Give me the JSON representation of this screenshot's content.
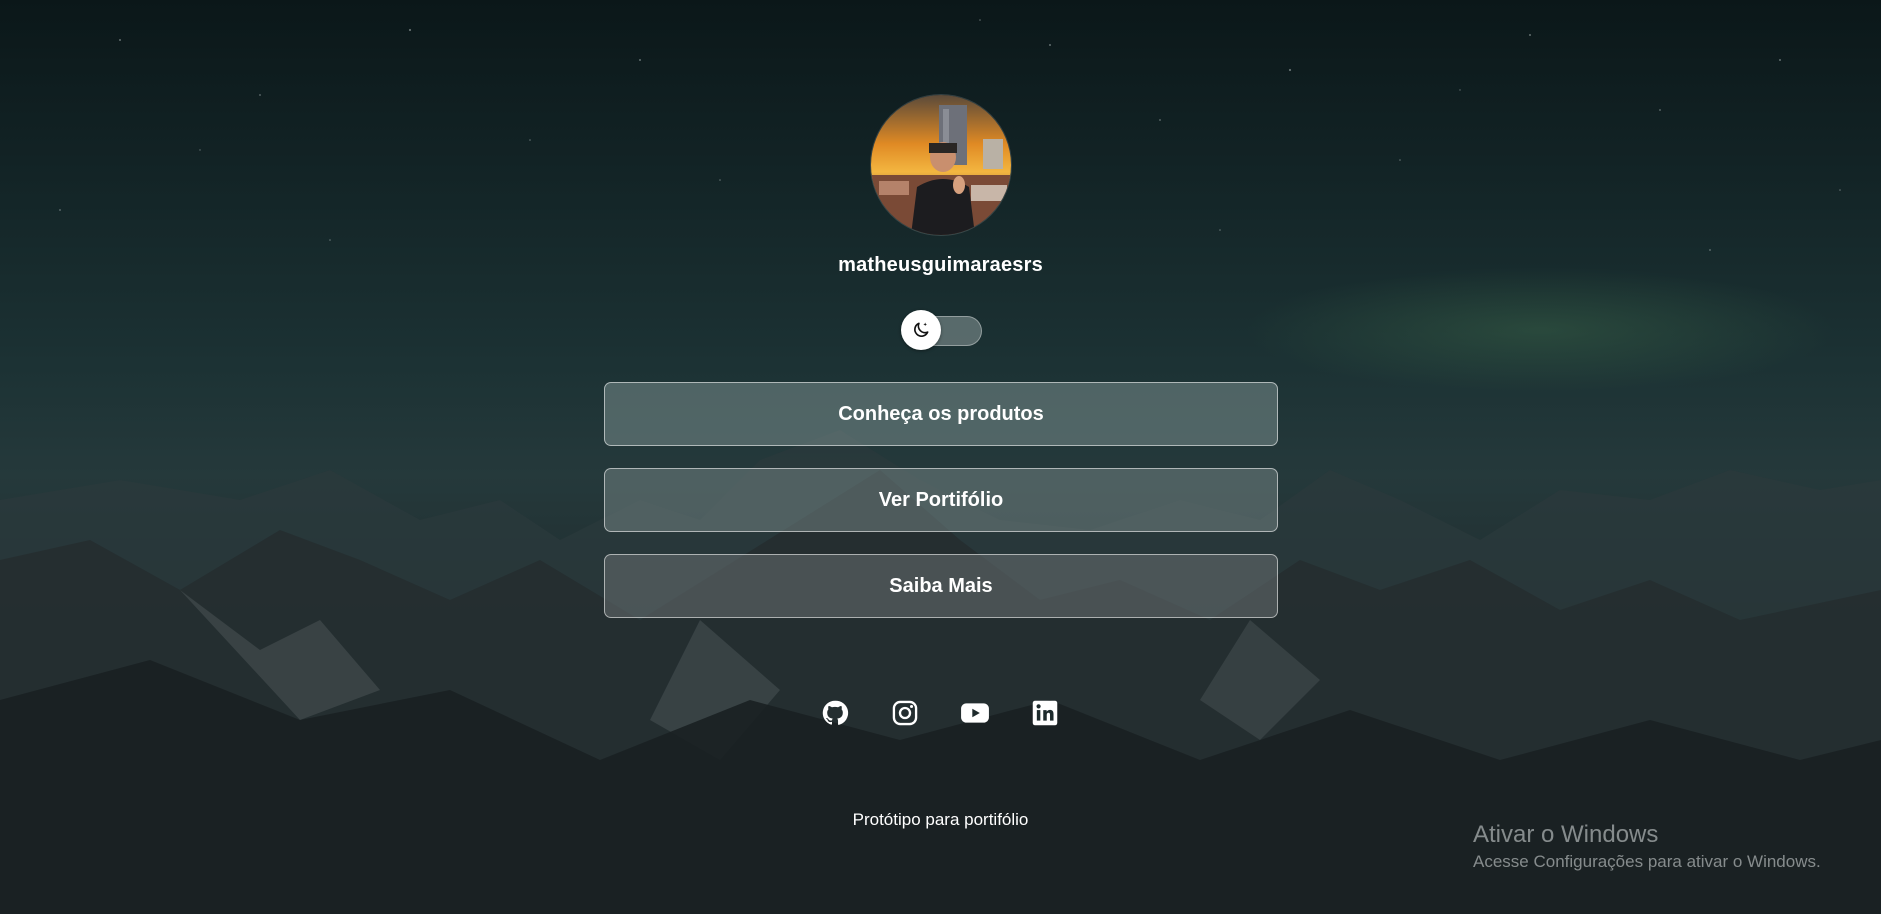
{
  "profile": {
    "username": "matheusguimaraesrs"
  },
  "theme_toggle": {
    "icon": "moon-icon",
    "state": "dark"
  },
  "links": [
    {
      "label": "Conheça os produtos"
    },
    {
      "label": "Ver Portifólio"
    },
    {
      "label": "Saiba Mais"
    }
  ],
  "socials": [
    {
      "icon": "github-icon"
    },
    {
      "icon": "instagram-icon"
    },
    {
      "icon": "youtube-icon"
    },
    {
      "icon": "linkedin-icon"
    }
  ],
  "footer": {
    "text": "Protótipo para portifólio"
  },
  "watermark": {
    "title": "Ativar o Windows",
    "subtitle": "Acesse Configurações para ativar o Windows."
  },
  "colors": {
    "text": "#ffffff",
    "background_top": "#0b1719",
    "background_mid": "#25393b"
  }
}
